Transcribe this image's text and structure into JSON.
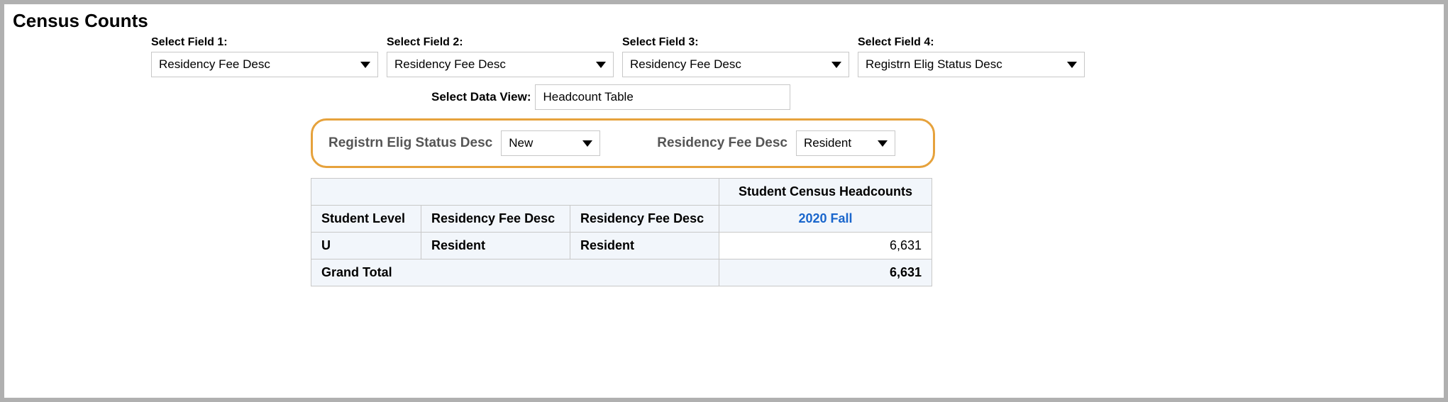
{
  "title": "Census Counts",
  "fields": {
    "f1": {
      "label": "Select Field 1:",
      "value": "Residency Fee Desc"
    },
    "f2": {
      "label": "Select Field 2:",
      "value": "Residency Fee Desc"
    },
    "f3": {
      "label": "Select Field 3:",
      "value": "Residency Fee Desc"
    },
    "f4": {
      "label": "Select Field 4:",
      "value": "Registrn Elig Status Desc"
    }
  },
  "dataview": {
    "label": "Select Data View:",
    "value": "Headcount Table"
  },
  "filters": {
    "a": {
      "label": "Registrn Elig Status Desc",
      "value": "New"
    },
    "b": {
      "label": "Residency Fee Desc",
      "value": "Resident"
    }
  },
  "table": {
    "top_header": "Student Census Headcounts",
    "cols": [
      "Student Level",
      "Residency Fee Desc",
      "Residency Fee Desc"
    ],
    "term": "2020 Fall",
    "rows": [
      {
        "c1": "U",
        "c2": "Resident",
        "c3": "Resident",
        "val": "6,631"
      }
    ],
    "grand_label": "Grand Total",
    "grand_val": "6,631"
  }
}
